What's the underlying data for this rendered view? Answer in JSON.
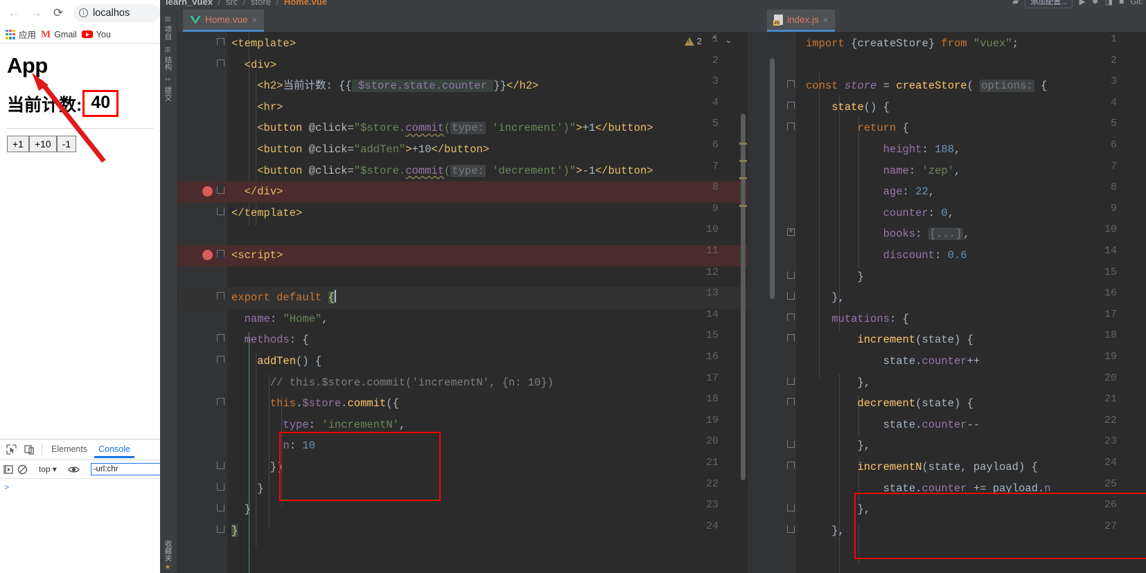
{
  "browser": {
    "nav": {
      "back": "←",
      "forward": "→",
      "reload": "⟳"
    },
    "omnibox": {
      "url": "localhos",
      "info_icon": "info-icon"
    },
    "bookmarks": [
      {
        "label": "应用",
        "icon": "apps-grid-icon"
      },
      {
        "label": "Gmail",
        "icon": "gmail-icon"
      },
      {
        "label": "You",
        "icon": "youtube-icon"
      }
    ],
    "page": {
      "heading": "App",
      "counter_label": "当前计数:",
      "counter_value": "40",
      "buttons": [
        "+1",
        "+10",
        "-1"
      ],
      "highlight_color": "#ff0000"
    }
  },
  "devtools": {
    "tabs": [
      {
        "label": "Elements",
        "active": false
      },
      {
        "label": "Console",
        "active": true
      }
    ],
    "icons": [
      "inspect-icon",
      "device-toolbar-icon",
      "execute-icon",
      "clear-console-icon",
      "eye-icon"
    ],
    "context": "top",
    "filter_value": "-url:chr",
    "prompt": ">"
  },
  "ide": {
    "breadcrumb": {
      "project": "learn_vuex",
      "src": "src",
      "store": "store",
      "file": "Home.vue"
    },
    "toolbar": {
      "run_config": "添加配置...",
      "right_text": "Git:"
    },
    "toolstrip": [
      "项目",
      "结构",
      "提交",
      "收藏夹"
    ],
    "left_panel": {
      "tab": {
        "name": "Home.vue",
        "icon": "vue-file-icon",
        "close": "×"
      },
      "warnings": {
        "count": "2",
        "icon": "warning-triangle-icon"
      },
      "lines": [
        {
          "n": "1",
          "fold": "arrow-down",
          "indent": 0,
          "html": "<span class='t-tag'>&lt;template&gt;</span>"
        },
        {
          "n": "2",
          "fold": "arrow-down",
          "indent": 1,
          "html": "  <span class='t-tag'>&lt;div&gt;</span>"
        },
        {
          "n": "3",
          "fold": "",
          "indent": 2,
          "html": "    <span class='t-tag'>&lt;h2&gt;</span><span class='t-cn'>当前计数: {{</span><span class='inject'> <span class='t-prop'>$store.state.counter</span> </span><span class='t-cn'>}}</span><span class='t-tag'>&lt;/h2&gt;</span>"
        },
        {
          "n": "4",
          "fold": "",
          "indent": 2,
          "html": "    <span class='t-tag'>&lt;hr&gt;</span>"
        },
        {
          "n": "5",
          "fold": "",
          "indent": 2,
          "html": "    <span class='t-tag'>&lt;button</span> <span class='t-attr'>@click=</span><span class='t-str'>\"$store.</span><span class='t-prop wavy'>commit</span><span class='t-str'>(</span><span class='hint'>type:</span> <span class='t-str'>'increment')\"</span><span class='t-tag'>&gt;</span><span class='t-txt'>+1</span><span class='t-tag'>&lt;/button&gt;</span>"
        },
        {
          "n": "6",
          "fold": "",
          "indent": 2,
          "html": "    <span class='t-tag'>&lt;button</span> <span class='t-attr'>@click=</span><span class='t-str'>\"addTen\"</span><span class='t-tag'>&gt;</span><span class='t-txt'>+10</span><span class='t-tag'>&lt;/button&gt;</span>"
        },
        {
          "n": "7",
          "fold": "",
          "indent": 2,
          "html": "    <span class='t-tag'>&lt;button</span> <span class='t-attr'>@click=</span><span class='t-str'>\"$store.</span><span class='t-prop wavy'>commit</span><span class='t-str'>(</span><span class='hint'>type:</span> <span class='t-str'>'decrement')\"</span><span class='t-tag'>&gt;</span><span class='t-txt'>-1</span><span class='t-tag'>&lt;/button&gt;</span>"
        },
        {
          "n": "8",
          "fold": "arrow-up",
          "bp": true,
          "hl": "red",
          "indent": 1,
          "html": "  <span class='t-tag'>&lt;/div&gt;</span>"
        },
        {
          "n": "9",
          "fold": "arrow-up",
          "indent": 0,
          "html": "<span class='t-tag'>&lt;/template&gt;</span>"
        },
        {
          "n": "10",
          "fold": "",
          "indent": 0,
          "html": ""
        },
        {
          "n": "11",
          "fold": "arrow-down",
          "bp": true,
          "hl": "red",
          "indent": 0,
          "html": "<span class='t-tag'>&lt;script&gt;</span>"
        },
        {
          "n": "12",
          "fold": "",
          "indent": 0,
          "html": ""
        },
        {
          "n": "13",
          "fold": "arrow-down",
          "hl": "gray",
          "indent": 0,
          "html": "<span class='t-kw'>export default</span> <span class='selbr t-tag'>{</span><span class='caret'></span>"
        },
        {
          "n": "14",
          "fold": "",
          "indent": 1,
          "html": "  <span class='t-prop'>name</span><span class='t-brace'>:</span> <span class='t-str'>\"Home\"</span><span class='t-brace'>,</span>"
        },
        {
          "n": "15",
          "fold": "arrow-down",
          "indent": 1,
          "html": "  <span class='t-prop'>methods</span><span class='t-brace'>: {</span>"
        },
        {
          "n": "16",
          "fold": "arrow-down",
          "indent": 2,
          "html": "    <span class='t-fn'>addTen</span><span class='t-brace'>() {</span>"
        },
        {
          "n": "17",
          "fold": "",
          "indent": 3,
          "html": "      <span class='t-comment'>// this.$store.commit('incrementN', {n: 10})</span>"
        },
        {
          "n": "18",
          "fold": "arrow-down",
          "indent": 3,
          "html": "      <span class='t-kw'>this</span><span class='t-brace'>.</span><span class='t-prop'>$store</span><span class='t-brace'>.</span><span class='t-fn'>commit</span><span class='t-brace'>({</span>"
        },
        {
          "n": "19",
          "fold": "",
          "indent": 4,
          "html": "        <span class='t-prop'>type</span><span class='t-brace'>:</span> <span class='t-str'>'incrementN'</span><span class='t-brace'>,</span>"
        },
        {
          "n": "20",
          "fold": "",
          "indent": 4,
          "html": "        <span class='t-prop'>n</span><span class='t-brace'>:</span> <span class='t-num'>10</span>"
        },
        {
          "n": "21",
          "fold": "arrow-up",
          "indent": 3,
          "html": "      <span class='t-brace'>})</span>"
        },
        {
          "n": "22",
          "fold": "arrow-up",
          "indent": 2,
          "html": "    <span class='t-brace'>}</span>"
        },
        {
          "n": "23",
          "fold": "arrow-up",
          "indent": 1,
          "html": "  <span class='t-brace'>}</span>"
        },
        {
          "n": "24",
          "fold": "arrow-up",
          "indent": 0,
          "html": "<span class='selbr t-tag'>}</span>"
        }
      ]
    },
    "right_panel": {
      "tab": {
        "name": "index.js",
        "icon": "js-file-icon",
        "close": "×"
      },
      "lines": [
        {
          "n": "1",
          "fold": "",
          "html": "<span class='t-kw'>import</span> <span class='t-brace'>{</span><span class='t-txt'>createStore</span><span class='t-brace'>}</span> <span class='t-kw'>from</span> <span class='t-str'>\"vuex\"</span><span class='t-brace'>;</span>"
        },
        {
          "n": "2",
          "fold": "",
          "html": ""
        },
        {
          "n": "3",
          "fold": "arrow-down",
          "html": "<span class='t-kw'>const</span> <span class='t-italic'>store</span> <span class='t-brace'>=</span> <span class='t-fn'>createStore</span><span class='t-brace'>(</span> <span class='hint'>options:</span> <span class='t-brace'>{</span>"
        },
        {
          "n": "4",
          "fold": "arrow-down",
          "html": "    <span class='t-fn'>state</span><span class='t-brace'>() {</span>"
        },
        {
          "n": "5",
          "fold": "arrow-down",
          "html": "        <span class='t-kw'>return</span> <span class='t-brace'>{</span>"
        },
        {
          "n": "6",
          "fold": "",
          "html": "            <span class='t-prop'>height</span><span class='t-brace'>:</span> <span class='t-num'>188</span><span class='t-brace'>,</span>"
        },
        {
          "n": "7",
          "fold": "",
          "html": "            <span class='t-prop'>name</span><span class='t-brace'>:</span> <span class='t-str'>'zep'</span><span class='t-brace'>,</span>"
        },
        {
          "n": "8",
          "fold": "",
          "html": "            <span class='t-prop'>age</span><span class='t-brace'>:</span> <span class='t-num'>22</span><span class='t-brace'>,</span>"
        },
        {
          "n": "9",
          "fold": "",
          "html": "            <span class='t-prop'>counter</span><span class='t-brace'>:</span> <span class='t-num'>0</span><span class='t-brace'>,</span>"
        },
        {
          "n": "10",
          "fold": "plus",
          "html": "            <span class='t-prop'>books</span><span class='t-brace'>:</span> <span class='hint'>[...]</span><span class='t-brace'>,</span>"
        },
        {
          "n": "14",
          "fold": "",
          "html": "            <span class='t-prop'>discount</span><span class='t-brace'>:</span> <span class='t-num'>0.6</span>"
        },
        {
          "n": "15",
          "fold": "arrow-up",
          "html": "        <span class='t-brace'>}</span>"
        },
        {
          "n": "16",
          "fold": "arrow-up",
          "html": "    <span class='t-brace'>},</span>"
        },
        {
          "n": "17",
          "fold": "arrow-down",
          "html": "    <span class='t-prop'>mutations</span><span class='t-brace'>: {</span>"
        },
        {
          "n": "18",
          "fold": "arrow-down",
          "html": "        <span class='t-fn'>increment</span><span class='t-brace'>(</span><span class='t-param'>state</span><span class='t-brace'>) {</span>"
        },
        {
          "n": "19",
          "fold": "",
          "html": "            <span class='t-param'>state</span><span class='t-brace'>.</span><span class='t-prop'>counter</span><span class='t-brace'>++</span>"
        },
        {
          "n": "20",
          "fold": "arrow-up",
          "html": "        <span class='t-brace'>},</span>"
        },
        {
          "n": "21",
          "fold": "arrow-down",
          "html": "        <span class='t-fn'>decrement</span><span class='t-brace'>(</span><span class='t-param'>state</span><span class='t-brace'>) {</span>"
        },
        {
          "n": "22",
          "fold": "",
          "html": "            <span class='t-param'>state</span><span class='t-brace'>.</span><span class='t-prop'>counter</span><span class='t-brace'>--</span>"
        },
        {
          "n": "23",
          "fold": "arrow-up",
          "html": "        <span class='t-brace'>},</span>"
        },
        {
          "n": "24",
          "fold": "arrow-down",
          "html": "        <span class='t-fn'>incrementN</span><span class='t-brace'>(</span><span class='t-param'>state, payload</span><span class='t-brace'>) {</span>"
        },
        {
          "n": "25",
          "fold": "",
          "html": "            <span class='t-param'>state</span><span class='t-brace'>.</span><span class='t-prop'>counter</span> <span class='t-brace'>+=</span> <span class='t-param'>payload</span><span class='t-brace'>.</span><span class='t-prop'>n</span>"
        },
        {
          "n": "26",
          "fold": "arrow-up",
          "html": "        <span class='t-brace'>},</span>"
        },
        {
          "n": "27",
          "fold": "arrow-up",
          "html": "    <span class='t-brace'>},</span>"
        }
      ]
    }
  },
  "annotations": {
    "arrow_color": "#e01b1b",
    "box_color": "#ff0000"
  }
}
